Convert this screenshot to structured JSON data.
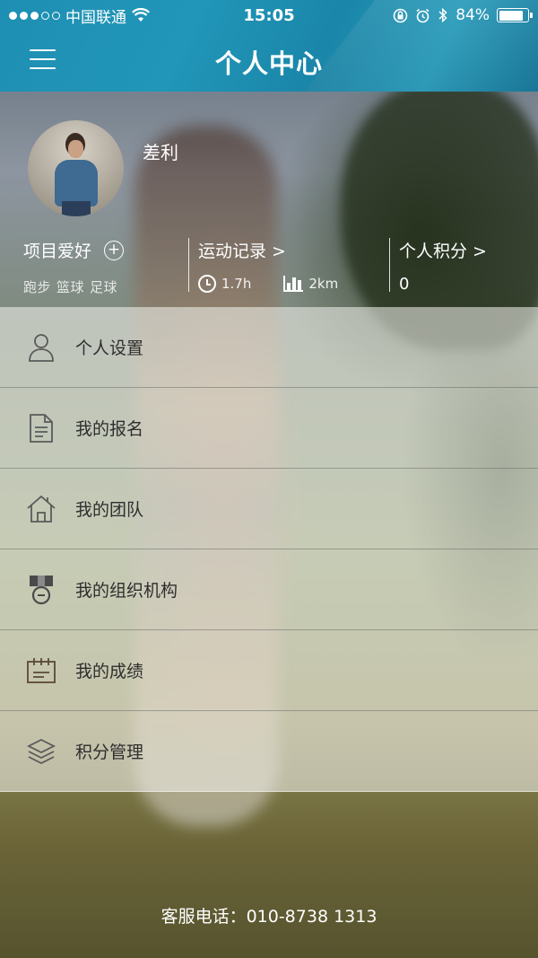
{
  "status_bar": {
    "carrier": "中国联通",
    "time": "15:05",
    "battery": "84%",
    "icons": [
      "signal-dots-icon",
      "wifi-icon",
      "screen-rotation-lock-icon",
      "alarm-icon",
      "bluetooth-icon",
      "battery-icon"
    ]
  },
  "header": {
    "title": "个人中心",
    "menu_icon": "hamburger-menu-icon"
  },
  "profile": {
    "username": "差利",
    "hobby": {
      "title": "项目爱好",
      "add_icon": "plus-circle-icon",
      "tags": [
        "跑步",
        "篮球",
        "足球"
      ]
    },
    "record": {
      "title": "运动记录 >",
      "duration": "1.7h",
      "distance": "2km",
      "duration_icon": "clock-icon",
      "distance_icon": "bar-chart-icon"
    },
    "points": {
      "title": "个人积分 >",
      "value": "0"
    }
  },
  "menu": {
    "items": [
      {
        "label": "个人设置",
        "icon": "user-icon"
      },
      {
        "label": "我的报名",
        "icon": "document-icon"
      },
      {
        "label": "我的团队",
        "icon": "home-icon"
      },
      {
        "label": "我的组织机构",
        "icon": "medal-icon"
      },
      {
        "label": "我的成绩",
        "icon": "calendar-icon"
      },
      {
        "label": "积分管理",
        "icon": "layers-icon"
      }
    ]
  },
  "footer": {
    "hotline": "客服电话：010-8738 1313"
  },
  "colors": {
    "header": "#2196b8",
    "menu_text": "#2e2e2e",
    "icon": "#5a5a5a"
  }
}
